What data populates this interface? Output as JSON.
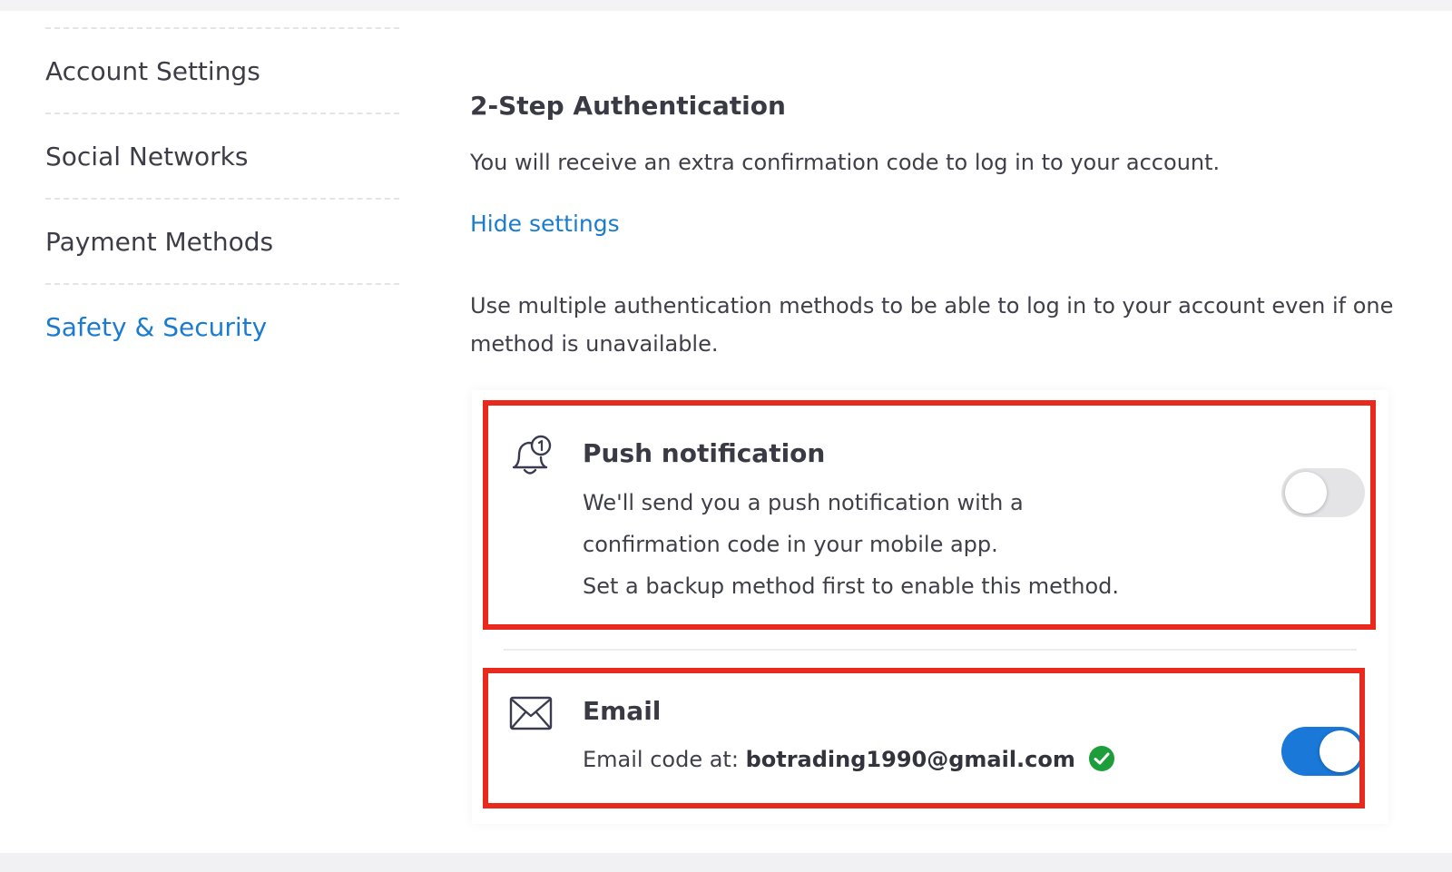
{
  "sidebar": {
    "items": [
      {
        "label": "Account Settings",
        "active": false
      },
      {
        "label": "Social Networks",
        "active": false
      },
      {
        "label": "Payment Methods",
        "active": false
      },
      {
        "label": "Safety & Security",
        "active": true
      }
    ]
  },
  "main": {
    "title": "2-Step Authentication",
    "description": "You will receive an extra confirmation code to log in to your account.",
    "hide_settings_label": "Hide settings",
    "methods_intro": "Use multiple authentication methods to be able to log in to your account even if one method is unavailable."
  },
  "methods": {
    "push": {
      "icon": "bell-notification-icon",
      "title": "Push notification",
      "description_line1": "We'll send you a push notification with a",
      "description_line2": "confirmation code in your mobile app.",
      "description_line3": "Set a backup method first to enable this method.",
      "enabled": false
    },
    "email": {
      "icon": "envelope-icon",
      "title": "Email",
      "code_prefix": "Email code at:",
      "address": "botrading1990@gmail.com",
      "verified_icon": "check-circle-icon",
      "enabled": true
    }
  },
  "colors": {
    "accent": "#1b7ccf",
    "toggle_on": "#1a78d8",
    "toggle_off": "#e4e4e7",
    "highlight": "#e8291c",
    "verified": "#1e9e3a"
  }
}
